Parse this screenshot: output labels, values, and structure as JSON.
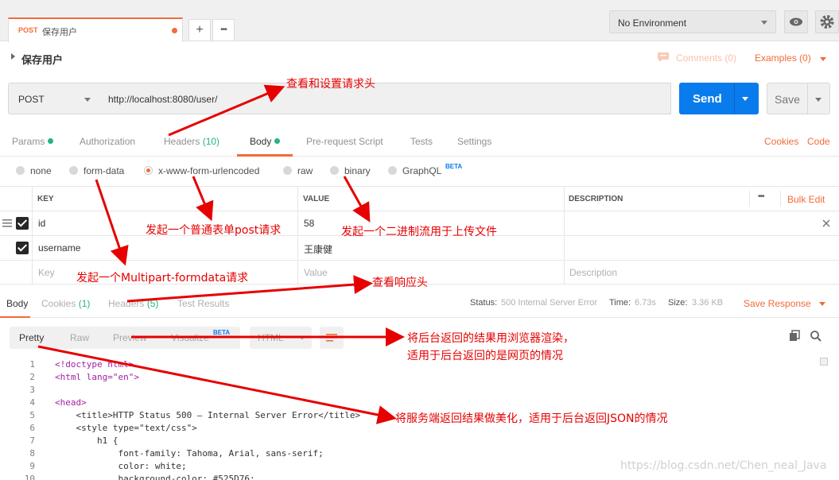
{
  "tab": {
    "method": "POST",
    "name": "保存用户",
    "plus": "+",
    "more": "•••"
  },
  "environment": {
    "selected": "No Environment"
  },
  "request_title": "保存用户",
  "comments": "Comments (0)",
  "examples": "Examples (0)",
  "request": {
    "method": "POST",
    "url": "http://localhost:8080/user/",
    "send": "Send",
    "save": "Save"
  },
  "req_tabs": {
    "params": "Params",
    "authorization": "Authorization",
    "headers": "Headers",
    "headers_count": "(10)",
    "body": "Body",
    "pre_request": "Pre-request Script",
    "tests": "Tests",
    "settings": "Settings",
    "cookies": "Cookies",
    "code": "Code"
  },
  "body_modes": {
    "none": "none",
    "form_data": "form-data",
    "urlencoded": "x-www-form-urlencoded",
    "raw": "raw",
    "binary": "binary",
    "graphql": "GraphQL",
    "beta": "BETA"
  },
  "table": {
    "headers": {
      "key": "KEY",
      "value": "VALUE",
      "description": "DESCRIPTION",
      "more": "•••",
      "bulk_edit": "Bulk Edit"
    },
    "rows": [
      {
        "key": "id",
        "value": "58"
      },
      {
        "key": "username",
        "value": "王康健"
      }
    ],
    "placeholders": {
      "key": "Key",
      "value": "Value",
      "description": "Description"
    }
  },
  "response": {
    "tabs": {
      "body": "Body",
      "cookies": "Cookies",
      "cookies_count": "(1)",
      "headers": "Headers",
      "headers_count": "(5)",
      "test_results": "Test Results"
    },
    "status_label": "Status:",
    "status_value": "500 Internal Server Error",
    "time_label": "Time:",
    "time_value": "6.73s",
    "size_label": "Size:",
    "size_value": "3.36 KB",
    "save_response": "Save Response"
  },
  "format": {
    "pretty": "Pretty",
    "raw": "Raw",
    "preview": "Preview",
    "visualize": "Visualize",
    "beta": "BETA",
    "lang": "HTML"
  },
  "code_lines": [
    {
      "n": "1",
      "text": "<!doctype html>"
    },
    {
      "n": "2",
      "text": "<html lang=\"en\">"
    },
    {
      "n": "3",
      "text": ""
    },
    {
      "n": "4",
      "text": "<head>"
    },
    {
      "n": "5",
      "text": "    <title>HTTP Status 500 – Internal Server Error</title>"
    },
    {
      "n": "6",
      "text": "    <style type=\"text/css\">"
    },
    {
      "n": "7",
      "text": "        h1 {"
    },
    {
      "n": "8",
      "text": "            font-family: Tahoma, Arial, sans-serif;"
    },
    {
      "n": "9",
      "text": "            color: white;"
    },
    {
      "n": "10",
      "text": "            background-color: #525D76;"
    }
  ],
  "annotations": {
    "headers": "查看和设置请求头",
    "urlencoded": "发起一个普通表单post请求",
    "binary": "发起一个二进制流用于上传文件",
    "form_data": "发起一个Multipart-formdata请求",
    "resp_headers": "查看响应头",
    "preview_line1": "将后台返回的结果用浏览器渲染，",
    "preview_line2": "适用于后台返回的是网页的情况",
    "pretty": "将服务端返回结果做美化，适用于后台返回JSON的情况"
  },
  "watermark": "https://blog.csdn.net/Chen_neal_Java",
  "colors": {
    "accent": "#f26b3a",
    "send": "#097bed",
    "success": "#26b47f",
    "annotation": "#e60000"
  }
}
